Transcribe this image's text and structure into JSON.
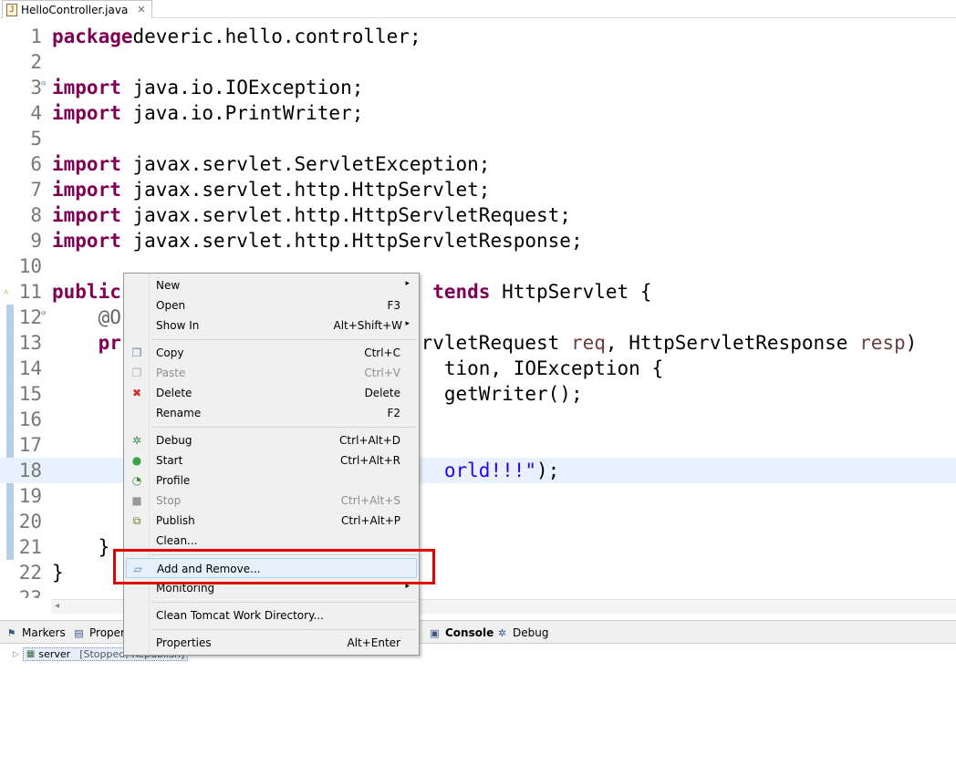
{
  "editor_tab": {
    "filename": "HelloController.java",
    "close": "✕",
    "file_glyph": "J"
  },
  "code_lines": [
    {
      "n": "1",
      "segs": [
        [
          "kw",
          "package"
        ],
        [
          "",
          "deveric.hello.controller;"
        ]
      ]
    },
    {
      "n": "2",
      "segs": []
    },
    {
      "n": "3",
      "segs": [
        [
          "kw",
          "import"
        ],
        [
          "",
          " java.io.IOException;"
        ]
      ],
      "fold": true
    },
    {
      "n": "4",
      "segs": [
        [
          "kw",
          "import"
        ],
        [
          "",
          " java.io.PrintWriter;"
        ]
      ]
    },
    {
      "n": "5",
      "segs": []
    },
    {
      "n": "6",
      "segs": [
        [
          "kw",
          "import"
        ],
        [
          "",
          " javax.servlet.ServletException;"
        ]
      ]
    },
    {
      "n": "7",
      "segs": [
        [
          "kw",
          "import"
        ],
        [
          "",
          " javax.servlet.http.HttpServlet;"
        ]
      ]
    },
    {
      "n": "8",
      "segs": [
        [
          "kw",
          "import"
        ],
        [
          "",
          " javax.servlet.http.HttpServletRequest;"
        ]
      ]
    },
    {
      "n": "9",
      "segs": [
        [
          "kw",
          "import"
        ],
        [
          "",
          " javax.servlet.http.HttpServletResponse;"
        ]
      ]
    },
    {
      "n": "10",
      "segs": []
    },
    {
      "n": "11",
      "segs": [
        [
          "kw",
          "public"
        ],
        [
          "",
          "                           "
        ],
        [
          "kw",
          "tends"
        ],
        [
          "",
          " HttpServlet {"
        ]
      ],
      "warn": true
    },
    {
      "n": "12",
      "segs": [
        [
          "",
          "    "
        ],
        [
          "ann",
          "@O"
        ]
      ],
      "fold": true
    },
    {
      "n": "13",
      "segs": [
        [
          "",
          "    "
        ],
        [
          "kw",
          "pr"
        ],
        [
          "",
          "                          rvletRequest "
        ],
        [
          "var",
          "req"
        ],
        [
          "",
          ", HttpServletResponse "
        ],
        [
          "var",
          "resp"
        ],
        [
          "",
          ")"
        ]
      ]
    },
    {
      "n": "14",
      "segs": [
        [
          "",
          "                                  tion, IOException {"
        ]
      ]
    },
    {
      "n": "15",
      "segs": [
        [
          "",
          "                                  getWriter();"
        ]
      ]
    },
    {
      "n": "16",
      "segs": []
    },
    {
      "n": "17",
      "segs": []
    },
    {
      "n": "18",
      "segs": [
        [
          "",
          "                                  "
        ],
        [
          "str",
          "orld!!!\""
        ],
        [
          "",
          ");"
        ]
      ],
      "highlight": true
    },
    {
      "n": "19",
      "segs": []
    },
    {
      "n": "20",
      "segs": []
    },
    {
      "n": "21",
      "segs": [
        [
          "",
          "    }"
        ]
      ]
    },
    {
      "n": "22",
      "segs": [
        [
          "",
          "}"
        ]
      ]
    },
    {
      "n": "23",
      "segs": []
    }
  ],
  "colors": {
    "keyword": "#7f0055",
    "string": "#2a00ff",
    "variable": "#6a3e3e",
    "highlight_line": "#e8f2fe",
    "callout": "#e00000"
  },
  "view_tabs": [
    {
      "label": "Markers",
      "icon": "markers-icon",
      "glyph": "⚑"
    },
    {
      "label": "Proper",
      "icon": "properties-icon",
      "glyph": "▤"
    },
    {
      "label": "Console",
      "icon": "console-icon",
      "glyph": "▣",
      "active": true
    },
    {
      "label": "Debug",
      "icon": "debug-icon",
      "glyph": "✲"
    }
  ],
  "server_row": {
    "name": "server",
    "status": "[Stopped, Republish]"
  },
  "context_menu": [
    {
      "type": "item",
      "label": "New",
      "submenu": true
    },
    {
      "type": "item",
      "label": "Open",
      "shortcut": "F3"
    },
    {
      "type": "item",
      "label": "Show In",
      "shortcut": "Alt+Shift+W",
      "submenu": true
    },
    {
      "type": "sep"
    },
    {
      "type": "item",
      "label": "Copy",
      "shortcut": "Ctrl+C",
      "icon": "copy-icon",
      "glyph": "❐",
      "glyph_color": "#5a7fa8"
    },
    {
      "type": "item",
      "label": "Paste",
      "shortcut": "Ctrl+V",
      "icon": "paste-icon",
      "glyph": "❐",
      "glyph_color": "#b0b0b0",
      "disabled": true
    },
    {
      "type": "item",
      "label": "Delete",
      "shortcut": "Delete",
      "icon": "delete-icon",
      "glyph": "✖",
      "glyph_color": "#d22b2b"
    },
    {
      "type": "item",
      "label": "Rename",
      "shortcut": "F2"
    },
    {
      "type": "sep"
    },
    {
      "type": "item",
      "label": "Debug",
      "shortcut": "Ctrl+Alt+D",
      "icon": "debug-icon",
      "glyph": "✲",
      "glyph_color": "#3f8f3f"
    },
    {
      "type": "item",
      "label": "Start",
      "shortcut": "Ctrl+Alt+R",
      "icon": "start-icon",
      "glyph": "●",
      "glyph_color": "#3aa34a"
    },
    {
      "type": "item",
      "label": "Profile",
      "icon": "profile-icon",
      "glyph": "◔",
      "glyph_color": "#3f8f3f"
    },
    {
      "type": "item",
      "label": "Stop",
      "shortcut": "Ctrl+Alt+S",
      "icon": "stop-icon",
      "glyph": "■",
      "glyph_color": "#9a9a9a",
      "disabled": true
    },
    {
      "type": "item",
      "label": "Publish",
      "shortcut": "Ctrl+Alt+P",
      "icon": "publish-icon",
      "glyph": "⧉",
      "glyph_color": "#6b7f2e"
    },
    {
      "type": "item",
      "label": "Clean..."
    },
    {
      "type": "sep"
    },
    {
      "type": "item",
      "label": "Add and Remove...",
      "icon": "add-remove-icon",
      "glyph": "▱",
      "glyph_color": "#5a7fa8",
      "selected": true
    },
    {
      "type": "item",
      "label": "Monitoring",
      "submenu": true
    },
    {
      "type": "sep"
    },
    {
      "type": "item",
      "label": "Clean Tomcat Work Directory..."
    },
    {
      "type": "sep"
    },
    {
      "type": "item",
      "label": "Properties",
      "shortcut": "Alt+Enter"
    }
  ]
}
